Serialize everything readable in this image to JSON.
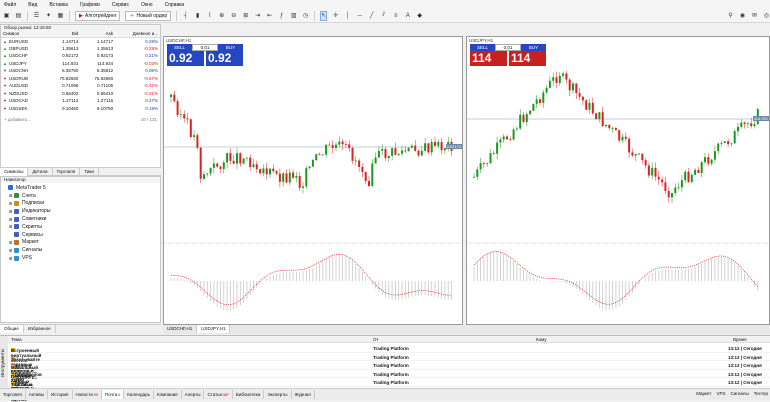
{
  "menu": [
    "Файл",
    "Вид",
    "Вставка",
    "Графики",
    "Сервис",
    "Окно",
    "Справка"
  ],
  "toolbar": {
    "algo": "Алготрейдинг",
    "new_order": "Новый ордер"
  },
  "market_watch": {
    "title": "Обзор рынка: 12:16:50",
    "columns": [
      "Символ",
      "Bid",
      "Ask",
      "Дневное и..."
    ],
    "rows": [
      {
        "symbol": "EURUSD",
        "bid": "1.14714",
        "ask": "1.14717",
        "chg": "0.28%",
        "dir": "up"
      },
      {
        "symbol": "GBPUSD",
        "bid": "1.35613",
        "ask": "1.35613",
        "chg": "-0.29%",
        "dir": "up"
      },
      {
        "symbol": "USDCHF",
        "bid": "0.92172",
        "ask": "0.92173",
        "chg": "0.21%",
        "dir": "up"
      },
      {
        "symbol": "USDJPY",
        "bid": "114.931",
        "ask": "114.934",
        "chg": "-0.03%",
        "dir": "up"
      },
      {
        "symbol": "USDCNH",
        "bid": "6.35750",
        "ask": "6.35812",
        "chg": "0.06%",
        "dir": "dn"
      },
      {
        "symbol": "USDRUB",
        "bid": "75.82660",
        "ask": "75.92660",
        "chg": "-0.67%",
        "dir": "dn"
      },
      {
        "symbol": "AUDUSD",
        "bid": "0.71096",
        "ask": "0.71105",
        "chg": "-0.42%",
        "dir": "dn"
      },
      {
        "symbol": "NZDUSD",
        "bid": "0.66402",
        "ask": "0.66410",
        "chg": "-0.21%",
        "dir": "dn"
      },
      {
        "symbol": "USDCAD",
        "bid": "1.27112",
        "ask": "1.27116",
        "chg": "0.27%",
        "dir": "dn"
      },
      {
        "symbol": "USDSEK",
        "bid": "9.10460",
        "ask": "9.10750",
        "chg": "0.19%",
        "dir": "dn"
      }
    ],
    "add": "+ добавить...",
    "count": "10 / 131",
    "tabs": [
      "Символы",
      "Детали",
      "Торговля",
      "Тики"
    ]
  },
  "navigator": {
    "title": "Навигатор",
    "items": [
      {
        "label": "MetaTrader 5",
        "icon": "mt5-icon",
        "color": "#2b6fd0"
      },
      {
        "label": "Счета",
        "icon": "accounts-icon",
        "color": "#3a8a3a"
      },
      {
        "label": "Подписки",
        "icon": "subscriptions-icon",
        "color": "#d08a20"
      },
      {
        "label": "Индикаторы",
        "icon": "indicators-icon",
        "color": "#4060c0"
      },
      {
        "label": "Советники",
        "icon": "experts-icon",
        "color": "#4060c0"
      },
      {
        "label": "Скрипты",
        "icon": "scripts-icon",
        "color": "#4060c0"
      },
      {
        "label": "Сервисы",
        "icon": "services-icon",
        "color": "#4060c0"
      },
      {
        "label": "Маркет",
        "icon": "market-icon",
        "color": "#c07020"
      },
      {
        "label": "Сигналы",
        "icon": "signals-icon",
        "color": "#2b90d0"
      },
      {
        "label": "VPS",
        "icon": "vps-icon",
        "color": "#2b90d0"
      }
    ],
    "tabs": [
      "Общие",
      "Избранное"
    ]
  },
  "chart1": {
    "title": "USDCHF,H1",
    "sell": "SELL",
    "buy": "BUY",
    "lot": "0.01",
    "bid_big": "0.92 17",
    "bid_sup": "2",
    "ask_big": "0.92 17",
    "ask_sup": "3",
    "price_label": "0.92172"
  },
  "chart2": {
    "title": "USDJPY,H1",
    "sell": "SELL",
    "buy": "BUY",
    "lot": "0.01",
    "bid_big": "114 93",
    "bid_sup": "1",
    "ask_big": "114 93",
    "ask_sup": "4",
    "price_label": "114.931"
  },
  "chart_tabs": [
    "USDCHF,H1",
    "USDJPY,H1"
  ],
  "toolbox": {
    "side": "Инструменты",
    "columns": {
      "topic": "Тема",
      "from": "От",
      "to": "Кому",
      "time": "Время"
    },
    "rows": [
      {
        "topic": "Встроенный виртуальный хостинг — торговля роботов и сигналов 24/7",
        "from": "Trading Platform",
        "time": "13:12 | Сегодня"
      },
      {
        "topic": "Заказывайте торговых роботов у фрилансеров — это быстро и эффективно",
        "from": "Trading Platform",
        "time": "13:12 | Сегодня"
      },
      {
        "topic": "Мобильный трейдинг — торгуйте из любого места в любое время!",
        "from": "Trading Platform",
        "time": "13:12 | Сегодня"
      },
      {
        "topic": "Покупайте готовых роботов и индикаторы в Маркете",
        "from": "Trading Platform",
        "time": "13:12 | Сегодня"
      },
      {
        "topic": "Торговые сигналы и копирование сделок",
        "from": "Trading Platform",
        "time": "13:12 | Сегодня"
      }
    ]
  },
  "bottom_tabs": [
    {
      "label": "Торговля",
      "badge": ""
    },
    {
      "label": "Активы",
      "badge": ""
    },
    {
      "label": "История",
      "badge": ""
    },
    {
      "label": "Новости",
      "badge": "99"
    },
    {
      "label": "Почта",
      "badge": "6"
    },
    {
      "label": "Календарь",
      "badge": ""
    },
    {
      "label": "Компания",
      "badge": ""
    },
    {
      "label": "Алерты",
      "badge": ""
    },
    {
      "label": "Статьи",
      "badge": "987"
    },
    {
      "label": "Библиотека",
      "badge": ""
    },
    {
      "label": "Эксперты",
      "badge": ""
    },
    {
      "label": "Журнал",
      "badge": ""
    }
  ],
  "bottom_right": [
    "Маркет",
    "VPS",
    "Сигналы",
    "Тестер"
  ]
}
